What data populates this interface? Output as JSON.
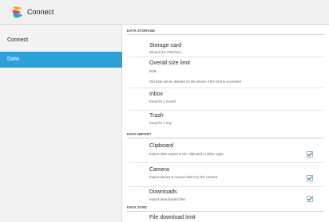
{
  "app": {
    "title": "Connect"
  },
  "sidebar": {
    "items": [
      {
        "label": "Connect"
      },
      {
        "label": "Data"
      }
    ]
  },
  "sections": {
    "storage": {
      "header": "DATA STORAGE",
      "storage_card": {
        "title": "Storage card",
        "subtitle": "sdcard (13.7GB free)"
      },
      "overall_size": {
        "title": "Overall size limit",
        "subtitle": "5GB",
        "note": "Old data will be deleted on the device if the limit is exceeded"
      },
      "inbox": {
        "title": "Inbox",
        "subtitle": "Keep for 1 month"
      },
      "trash": {
        "title": "Trash",
        "subtitle": "Keep for 1 day"
      }
    },
    "import": {
      "header": "DATA IMPORT",
      "clipboard": {
        "title": "Clipboard",
        "subtitle": "Import data copied to the clipboard in other Apps",
        "checked": true
      },
      "camera": {
        "title": "Camera",
        "subtitle": "Import photos & movies taken by the camera",
        "checked": true
      },
      "downloads": {
        "title": "Downloads",
        "subtitle": "Import downloaded files",
        "checked": true
      }
    },
    "sync": {
      "header": "DATA SYNC",
      "file_download_limit": {
        "title": "File download limit"
      }
    }
  },
  "colors": {
    "accent": "#2ba1d8",
    "check": "#2f8fd0"
  },
  "icons": {
    "app_logo": "connect-logo-icon",
    "checkbox": "checkmark-icon"
  }
}
